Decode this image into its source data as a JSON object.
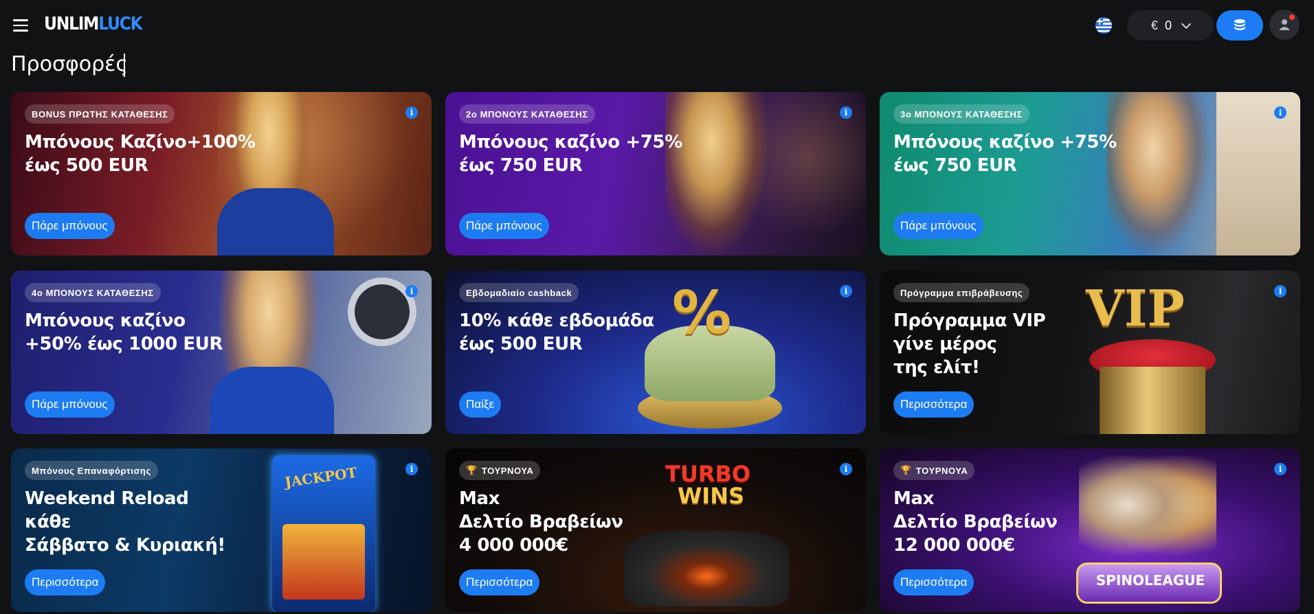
{
  "header": {
    "logo_part1": "UNLIM",
    "logo_part2": "LUCK",
    "balance_currency": "€",
    "balance_amount": "0"
  },
  "page_title": "Προσφορές",
  "cards": [
    {
      "badge": "BONUS ΠΡΩΤΗΣ ΚΑΤΑΘΕΣΗΣ",
      "headline": "Μπόνους Καζίνο+100%\nέως 500 EUR",
      "cta": "Πάρε μπόνους"
    },
    {
      "badge": "2ο ΜΠΟΝΟΥΣ ΚΑΤΑΘΕΣΗΣ",
      "headline": "Μπόνους καζίνο +75%\nέως 750 EUR",
      "cta": "Πάρε μπόνους"
    },
    {
      "badge": "3ο ΜΠΟΝΟΥΣ ΚΑΤΑΘΕΣΗΣ",
      "headline": "Μπόνους καζίνο +75%\nέως 750 EUR",
      "cta": "Πάρε μπόνους"
    },
    {
      "badge": "4ο ΜΠΟΝΟΥΣ ΚΑΤΑΘΕΣΗΣ",
      "headline": "Μπόνους καζίνο\n+50% έως 1000 EUR",
      "cta": "Πάρε μπόνους"
    },
    {
      "badge": "Εβδομαδιαίο cashback",
      "headline": "10% κάθε εβδομάδα\nέως 500 EUR",
      "cta": "Παίξε"
    },
    {
      "badge": "Πρόγραμμα επιβράβευσης",
      "headline": "Πρόγραμμα VIP\nγίνε μέρος\nτης ελίτ!",
      "cta": "Περισσότερα",
      "art_text": "VIP"
    },
    {
      "badge": "Μπόνους Επαναφόρτισης",
      "headline": "Weekend Reload\nκάθε\nΣάββατο & Κυριακή!",
      "cta": "Περισσότερα",
      "art_text": "JACKPOT"
    },
    {
      "badge": "ΤΟΥΡΝΟΥΑ",
      "headline": "Max\nΔελτίο Βραβείων\n4 000 000€",
      "cta": "Περισσότερα",
      "art_text_1": "TURBO",
      "art_text_2": "WINS"
    },
    {
      "badge": "ΤΟΥΡΝΟΥΑ",
      "headline": "Max\nΔελτίο Βραβείων\n12 000 000€",
      "cta": "Περισσότερα",
      "art_text": "SPINOLEAGUE"
    }
  ],
  "colors": {
    "accent": "#1d7cf2",
    "background": "#111214",
    "notification": "#ff3b3b"
  }
}
